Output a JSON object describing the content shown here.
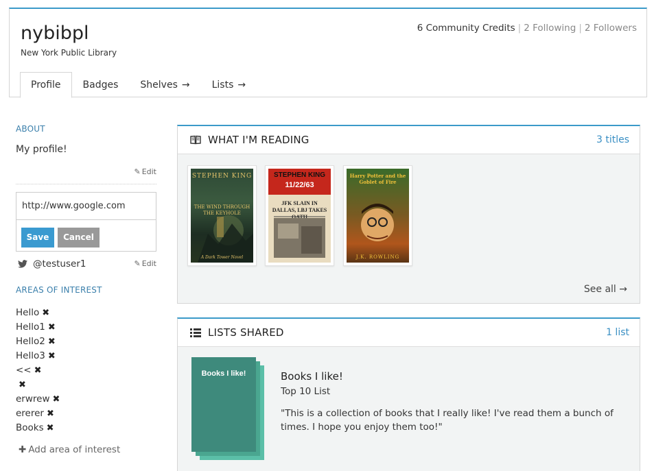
{
  "header": {
    "username": "nybibpl",
    "organization": "New York Public Library",
    "stats": {
      "credits": "6 Community Credits",
      "following": "2 Following",
      "followers": "2 Followers"
    },
    "tabs": [
      {
        "label": "Profile",
        "active": true
      },
      {
        "label": "Badges"
      },
      {
        "label": "Shelves",
        "arrow": "→"
      },
      {
        "label": "Lists",
        "arrow": "→"
      }
    ]
  },
  "sidebar": {
    "about_heading": "ABOUT",
    "about_text": "My profile!",
    "edit_label": "Edit",
    "url_input_value": "http://www.google.com",
    "save_label": "Save",
    "cancel_label": "Cancel",
    "twitter_handle": "@testuser1",
    "areas_heading": "AREAS OF INTEREST",
    "interests": [
      "Hello",
      "Hello1",
      "Hello2",
      "Hello3",
      "<<",
      "",
      "erwrew",
      "ererer",
      "Books"
    ],
    "remove_glyph": "✖",
    "add_interest_label": "Add area of interest"
  },
  "reading": {
    "title": "WHAT I'M READING",
    "count": "3 titles",
    "see_all": "See all",
    "books": [
      {
        "author": "STEPHEN KING",
        "title": "THE WIND THROUGH THE KEYHOLE",
        "subtitle": "A Dark Tower Novel"
      },
      {
        "author": "STEPHEN KING",
        "title": "11/22/63",
        "subtitle": "JFK SLAIN IN DALLAS, LBJ TAKES OATH"
      },
      {
        "author": "J.K. ROWLING",
        "title": "Harry Potter and the Goblet of Fire",
        "subtitle": ""
      }
    ]
  },
  "lists": {
    "title": "LISTS SHARED",
    "count": "1 list",
    "list_cover_text": "Books I like!",
    "list_name": "Books I like!",
    "list_type": "Top 10 List",
    "list_description": "\"This is a collection of books that I really like! I've read them a bunch of times. I hope you enjoy them too!\""
  },
  "colors": {
    "accent": "#3a9ac9",
    "save_button": "#3a9ad0",
    "cancel_button": "#999999",
    "list_cover": "#3e8a7c"
  }
}
